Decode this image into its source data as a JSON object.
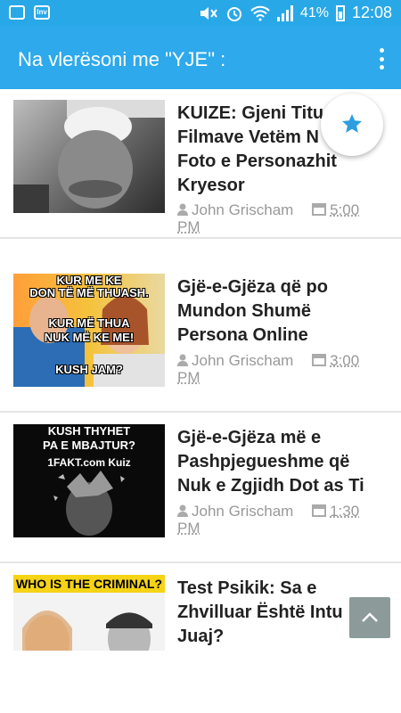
{
  "status_bar": {
    "battery": "41%",
    "time": "12:08",
    "inv_label": "Inv"
  },
  "app_bar": {
    "title": "Na vlerësoni me \"YJE\" :"
  },
  "colors": {
    "accent": "#2da9ec",
    "star": "#2d9fe0",
    "scroll_button": "#8c9a9a"
  },
  "articles": [
    {
      "title_lines": [
        "KUIZE: Gjeni Titu",
        "Filmave Vetëm N",
        "Foto e Personazhit",
        "Kryesor"
      ],
      "author": "John Grischam",
      "time_line1": "5:00",
      "time_line2": "PM",
      "thumb_captions": []
    },
    {
      "title_lines": [
        "Gjë-e-Gjëza që po",
        "Mundon Shumë",
        "Persona Online"
      ],
      "author": "John Grischam",
      "time_line1": "3:00",
      "time_line2": "PM",
      "thumb_captions": [
        "KUR ME KE",
        "DON TË MË THUASH.",
        "KUR MË THUA",
        "NUK MË KE ME!",
        "KUSH JAM?"
      ]
    },
    {
      "title_lines": [
        "Gjë-e-Gjëza më e",
        "Pashpjegueshme që",
        "Nuk e Zgjidh Dot as Ti"
      ],
      "author": "John Grischam",
      "time_line1": "1:30",
      "time_line2": "PM",
      "thumb_captions": [
        "KUSH THYHET",
        "PA E MBAJTUR?",
        "1FAKT.com Kuiz"
      ]
    },
    {
      "title_lines": [
        "Test Psikik: Sa e",
        "Zhvilluar Është Intu",
        "Juaj?"
      ],
      "author": "",
      "time_line1": "",
      "time_line2": "",
      "thumb_captions": [
        "WHO IS THE CRIMINAL?"
      ]
    }
  ]
}
